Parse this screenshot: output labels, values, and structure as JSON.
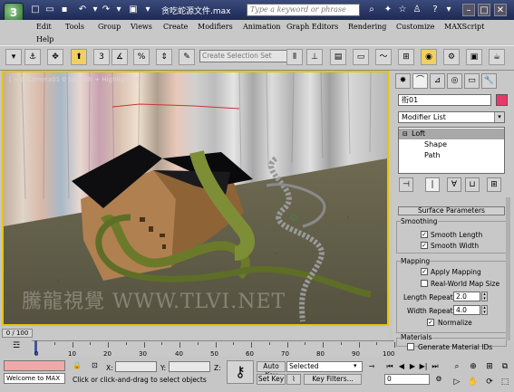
{
  "window": {
    "title": "贪吃蛇源文件.max",
    "search_placeholder": "Type a keyword or phrase"
  },
  "menu": [
    "Edit",
    "Tools",
    "Group",
    "Views",
    "Create",
    "Modifiers",
    "Animation",
    "Graph Editors",
    "Rendering",
    "Customize",
    "MAXScript",
    "Help"
  ],
  "toolbar": {
    "selection_set_placeholder": "Create Selection Set",
    "view_label": "View"
  },
  "viewport": {
    "label": "[ + 0 Camera01 0 Smooth + Highlights ]",
    "watermark": "騰龍視覺 WWW.TLVI.NET"
  },
  "panel": {
    "object_name": "衔01",
    "object_color": "#e8386a",
    "modifier_list": "Modifier List",
    "stack": [
      "Loft",
      "Shape",
      "Path"
    ],
    "rollout_title": "Surface Parameters",
    "smoothing": {
      "label": "Smoothing",
      "smooth_length": "Smooth Length",
      "smooth_width": "Smooth Width"
    },
    "mapping": {
      "label": "Mapping",
      "apply_mapping": "Apply Mapping",
      "real_world": "Real-World Map Size",
      "length_repeat_label": "Length Repeat:",
      "length_repeat": "2.0",
      "width_repeat_label": "Width Repeat:",
      "width_repeat": "4.0",
      "normalize": "Normalize"
    },
    "materials": {
      "label": "Materials",
      "generate_ids": "Generate Material IDs"
    }
  },
  "timeline": {
    "slider": "0 / 100",
    "ticks": [
      "0",
      "10",
      "20",
      "30",
      "40",
      "50",
      "60",
      "70",
      "80",
      "90",
      "100"
    ]
  },
  "status": {
    "maxscript": "Welcome to MAX",
    "x_label": "X:",
    "y_label": "Y:",
    "z_label": "Z:",
    "prompt": "Click or click-and-drag to select objects",
    "auto_key": "Auto Key",
    "set_key": "Set Key",
    "selected": "Selected",
    "key_filters": "Key Filters...",
    "frame": "0"
  }
}
